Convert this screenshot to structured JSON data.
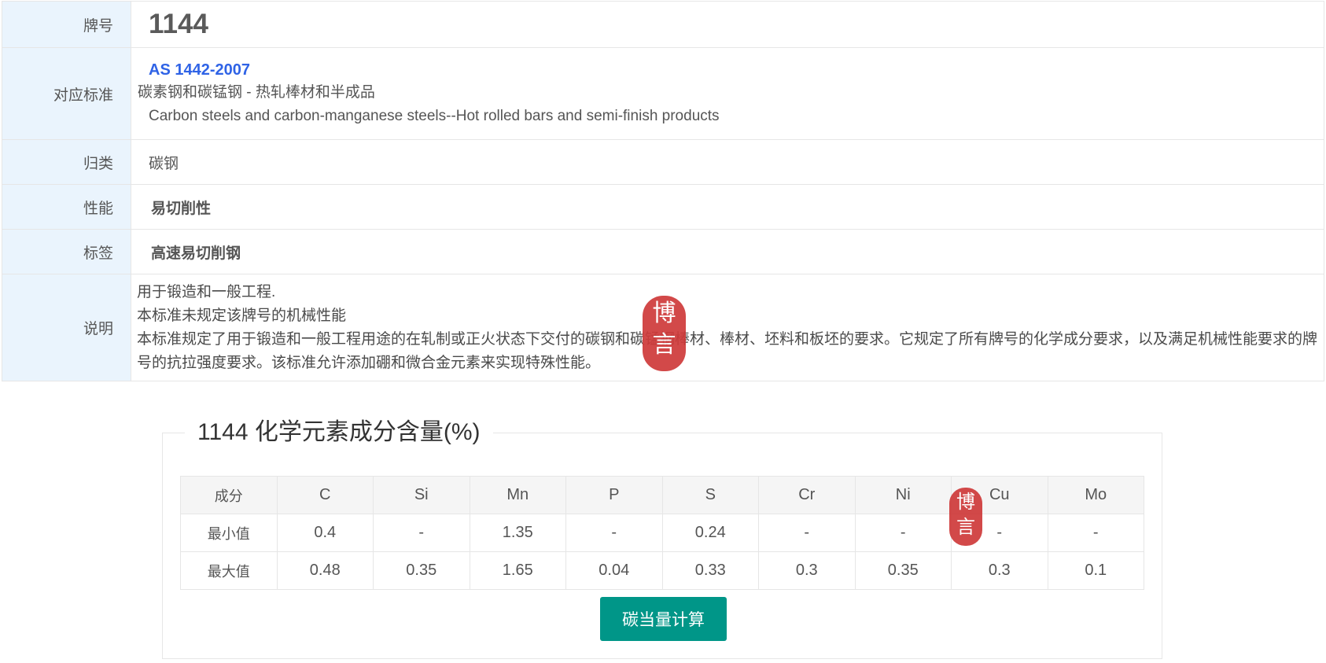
{
  "info": {
    "grade_label": "牌号",
    "grade_value": "1144",
    "standard_label": "对应标准",
    "standard_code": "AS 1442-2007",
    "standard_title_cn": "碳素钢和碳锰钢 - 热轧棒材和半成品",
    "standard_title_en": "Carbon steels and carbon-manganese steels--Hot rolled bars and semi-finish products",
    "category_label": "归类",
    "category_value": "碳钢",
    "performance_label": "性能",
    "performance_value": "易切削性",
    "tag_label": "标签",
    "tag_value": "高速易切削钢",
    "description_label": "说明",
    "description_lines": [
      "用于锻造和一般工程.",
      "本标准未规定该牌号的机械性能",
      "本标准规定了用于锻造和一般工程用途的在轧制或正火状态下交付的碳钢和碳锰钢棒材、棒材、坯料和板坯的要求。它规定了所有牌号的化学成分要求，以及满足机械性能要求的牌号的抗拉强度要求。该标准允许添加硼和微合金元素来实现特殊性能。"
    ]
  },
  "seal": {
    "text_top": "博",
    "text_bottom": "言",
    "color": "#cf3a3a"
  },
  "chemistry": {
    "title": "1144 化学元素成分含量(%)",
    "header_label": "成分",
    "elements": [
      "C",
      "Si",
      "Mn",
      "P",
      "S",
      "Cr",
      "Ni",
      "Cu",
      "Mo"
    ],
    "rows": [
      {
        "label": "最小值",
        "values": [
          "0.4",
          "-",
          "1.35",
          "-",
          "0.24",
          "-",
          "-",
          "-",
          "-"
        ]
      },
      {
        "label": "最大值",
        "values": [
          "0.48",
          "0.35",
          "1.65",
          "0.04",
          "0.33",
          "0.3",
          "0.35",
          "0.3",
          "0.1"
        ]
      }
    ],
    "button_label": "碳当量计算"
  },
  "colors": {
    "label_bg": "#eaf4fd",
    "link": "#2f63e6",
    "button": "#009688"
  }
}
